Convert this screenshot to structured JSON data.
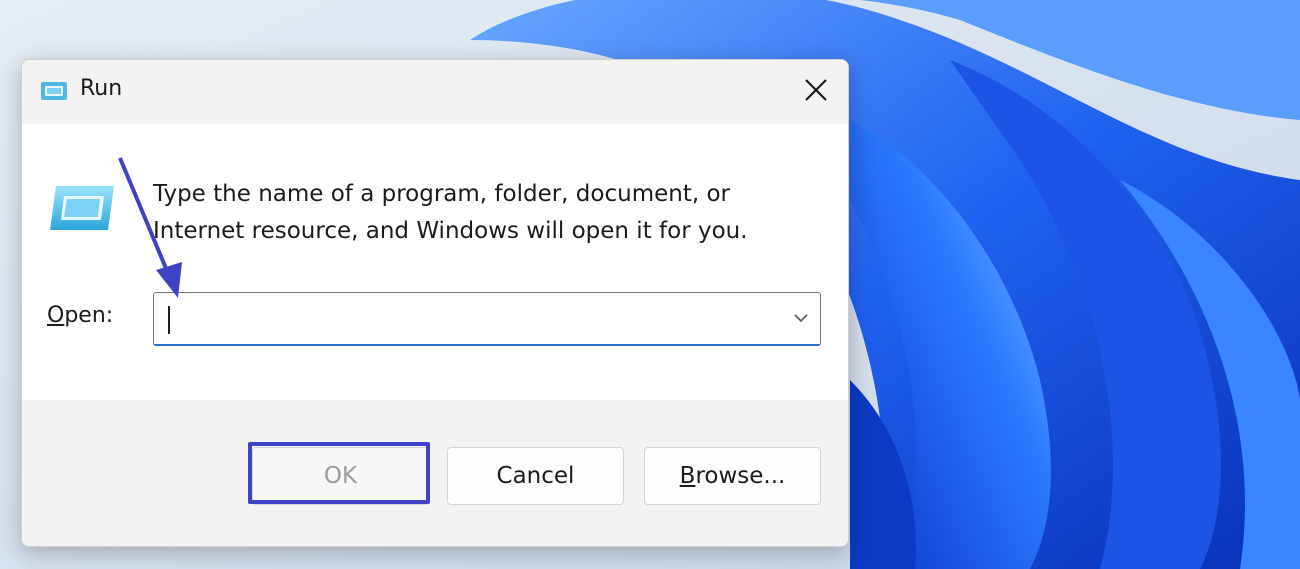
{
  "window": {
    "title": "Run",
    "icon": "run-app-icon",
    "close_icon": "close-icon"
  },
  "content": {
    "description_line1": "Type the name of a program, folder, document, or",
    "description_line2": "Internet resource, and Windows will open it for you.",
    "open_label_underlined": "O",
    "open_label_rest": "pen:",
    "open_input_value": "",
    "dropdown_icon": "chevron-down-icon"
  },
  "buttons": {
    "ok_label": "OK",
    "cancel_label": "Cancel",
    "browse_label_underlined": "B",
    "browse_label_rest": "rowse..."
  },
  "annotation": {
    "color": "#3e43c4",
    "arrow_target": "open-input",
    "highlight_target": "ok-button"
  },
  "colors": {
    "accent": "#2e6fd6",
    "wallpaper_blue": "#1a5de0"
  }
}
